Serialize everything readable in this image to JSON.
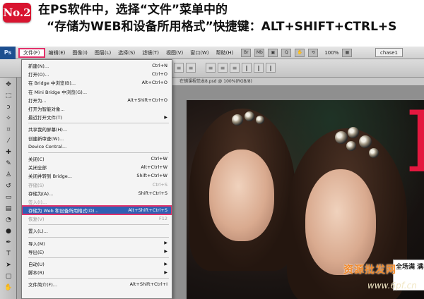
{
  "tutorial": {
    "step": "No.2",
    "line1": "在PS软件中，选择“文件”菜单中的",
    "line2": "“存储为WEB和设备所用格式”快捷键：ALT+SHIFT+CTRL+S"
  },
  "app": {
    "logo": "Ps",
    "menubar": [
      "文件(F)",
      "编辑(E)",
      "图像(I)",
      "图层(L)",
      "选择(S)",
      "滤镜(T)",
      "视图(V)",
      "窗口(W)",
      "帮助(H)"
    ],
    "toolbar_icons": [
      "Br",
      "Mb",
      "▣",
      "Q",
      "✋",
      "⟲",
      "▦"
    ],
    "zoom": "100%",
    "workspace": "chase1"
  },
  "document": {
    "tab_title": "在铺课程范本8.psd @ 100%(RGB/8)"
  },
  "file_menu": {
    "items": [
      {
        "label": "新建(N)...",
        "shortcut": "Ctrl+N"
      },
      {
        "label": "打开(O)...",
        "shortcut": "Ctrl+O"
      },
      {
        "label": "在 Bridge 中浏览(B)...",
        "shortcut": "Alt+Ctrl+O"
      },
      {
        "label": "在 Mini Bridge 中浏览(G)...",
        "shortcut": ""
      },
      {
        "label": "打开为...",
        "shortcut": "Alt+Shift+Ctrl+O"
      },
      {
        "label": "打开为智能对象...",
        "shortcut": ""
      },
      {
        "label": "最近打开文件(T)",
        "shortcut": "",
        "submenu": true
      },
      {
        "sep": true
      },
      {
        "label": "共享我的屏幕(H)...",
        "shortcut": ""
      },
      {
        "label": "创建新审查(W)...",
        "shortcut": ""
      },
      {
        "label": "Device Central...",
        "shortcut": ""
      },
      {
        "sep": true
      },
      {
        "label": "关闭(C)",
        "shortcut": "Ctrl+W"
      },
      {
        "label": "关闭全部",
        "shortcut": "Alt+Ctrl+W"
      },
      {
        "label": "关闭并转到 Bridge...",
        "shortcut": "Shift+Ctrl+W"
      },
      {
        "label": "存储(S)",
        "shortcut": "Ctrl+S",
        "disabled": true
      },
      {
        "label": "存储为(A)...",
        "shortcut": "Shift+Ctrl+S"
      },
      {
        "label": "签入(I)...",
        "shortcut": "",
        "disabled": true
      },
      {
        "label": "存储为 Web 和设备所用格式(D)...",
        "shortcut": "Alt+Shift+Ctrl+S",
        "highlight": true
      },
      {
        "label": "恢复(V)",
        "shortcut": "F12",
        "disabled": true
      },
      {
        "sep": true
      },
      {
        "label": "置入(L)...",
        "shortcut": ""
      },
      {
        "sep": true
      },
      {
        "label": "导入(M)",
        "shortcut": "",
        "submenu": true
      },
      {
        "label": "导出(E)",
        "shortcut": "",
        "submenu": true
      },
      {
        "sep": true
      },
      {
        "label": "自动(U)",
        "shortcut": "",
        "submenu": true
      },
      {
        "label": "脚本(R)",
        "shortcut": "",
        "submenu": true
      },
      {
        "sep": true
      },
      {
        "label": "文件简介(F)...",
        "shortcut": "Alt+Shift+Ctrl+I"
      }
    ]
  },
  "photo": {
    "promo_text": "全场满 满8",
    "watermark": "资源批发网",
    "watermark_url": "www.6pf.cn"
  },
  "colors": {
    "highlight": "#2f5fb3",
    "annotation": "#e2316a",
    "badge": "#d8142f",
    "brand_red": "#e3183f"
  }
}
